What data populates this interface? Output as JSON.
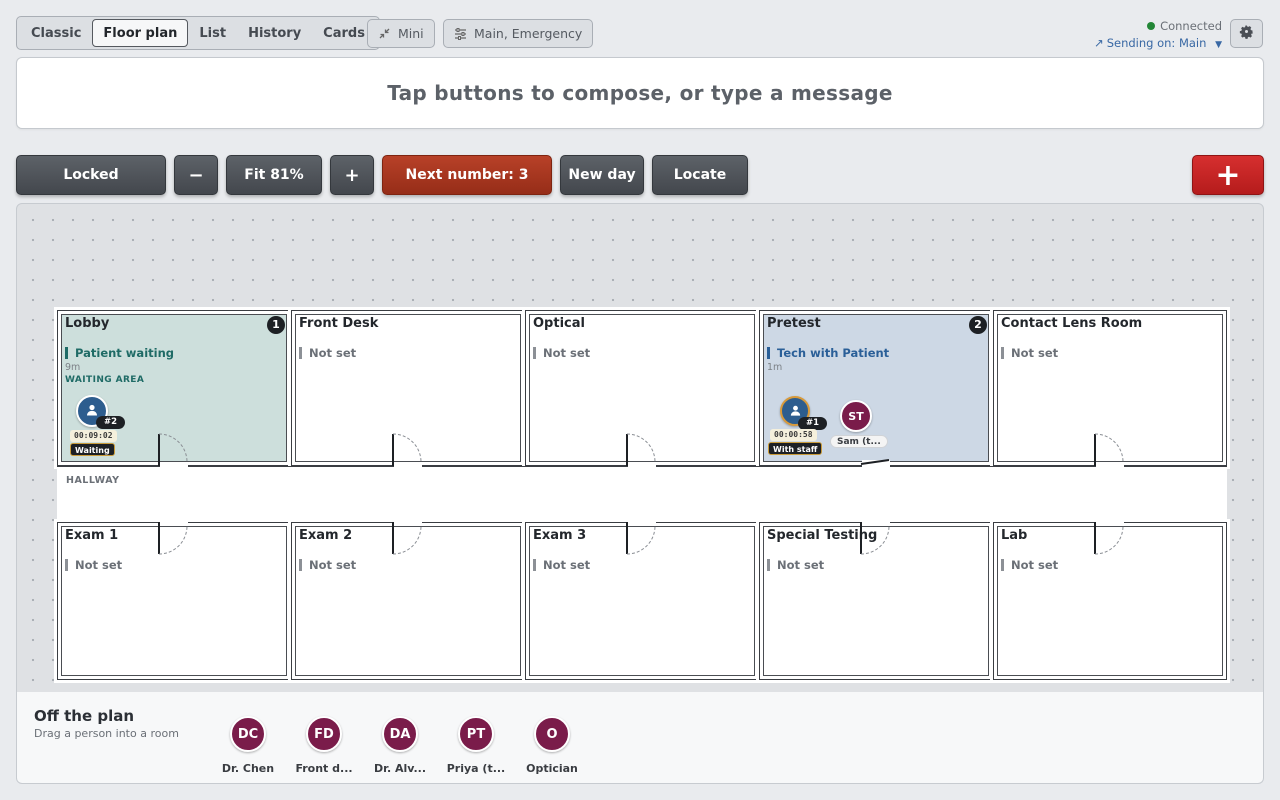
{
  "view_tabs": [
    "Classic",
    "Floor plan",
    "List",
    "History",
    "Cards"
  ],
  "active_tab": "Floor plan",
  "mini_label": "Mini",
  "channels_label": "Main, Emergency",
  "connection": {
    "status": "Connected",
    "sending": "Sending on: Main",
    "status_color": "#238636"
  },
  "compose_placeholder": "Tap buttons to compose, or type a message",
  "toolbar": {
    "locked": "Locked",
    "zoom_out": "−",
    "fit": "Fit 81%",
    "zoom_in": "+",
    "next_number": "Next number: 3",
    "new_day": "New day",
    "locate": "Locate",
    "emergency": "+"
  },
  "hallway_label": "HALLWAY",
  "rooms": {
    "lobby": {
      "name": "Lobby",
      "badge": "1",
      "status": "Patient waiting",
      "duration": "9m",
      "area": "WAITING AREA",
      "patient": {
        "number": "#2",
        "timer": "00:09:02",
        "state": "Waiting"
      }
    },
    "front_desk": {
      "name": "Front Desk",
      "status": "Not set"
    },
    "optical": {
      "name": "Optical",
      "status": "Not set"
    },
    "pretest": {
      "name": "Pretest",
      "badge": "2",
      "status": "Tech with Patient",
      "duration": "1m",
      "patient": {
        "number": "#1",
        "timer": "00:00:58",
        "state": "With staff"
      },
      "staff": {
        "initials": "ST",
        "name": "Sam (t..."
      }
    },
    "contact_lens": {
      "name": "Contact Lens Room",
      "status": "Not set"
    },
    "exam1": {
      "name": "Exam 1",
      "status": "Not set"
    },
    "exam2": {
      "name": "Exam 2",
      "status": "Not set"
    },
    "exam3": {
      "name": "Exam 3",
      "status": "Not set"
    },
    "special_testing": {
      "name": "Special Testing",
      "status": "Not set"
    },
    "lab": {
      "name": "Lab",
      "status": "Not set"
    }
  },
  "off_plan": {
    "title": "Off the plan",
    "subtitle": "Drag a person into a room",
    "people": [
      {
        "initials": "DC",
        "name": "Dr. Chen"
      },
      {
        "initials": "FD",
        "name": "Front d..."
      },
      {
        "initials": "DA",
        "name": "Dr. Alv..."
      },
      {
        "initials": "PT",
        "name": "Priya (t..."
      },
      {
        "initials": "O",
        "name": "Optician"
      }
    ]
  },
  "colors": {
    "staff": "#7a1c4a",
    "patient": "#2d5d8e",
    "waiting_room_bg": "#cddfdc",
    "pretest_room_bg": "#cdd8e5",
    "next_number_btn": "#b84128",
    "emergency_btn": "#d62f2f"
  },
  "icons": {
    "mini": "collapse-arrows-icon",
    "channels": "sliders-icon",
    "settings": "gear-icon",
    "patient": "person-icon",
    "sending": "arrow-up-right-icon",
    "dropdown": "caret-down-icon"
  }
}
